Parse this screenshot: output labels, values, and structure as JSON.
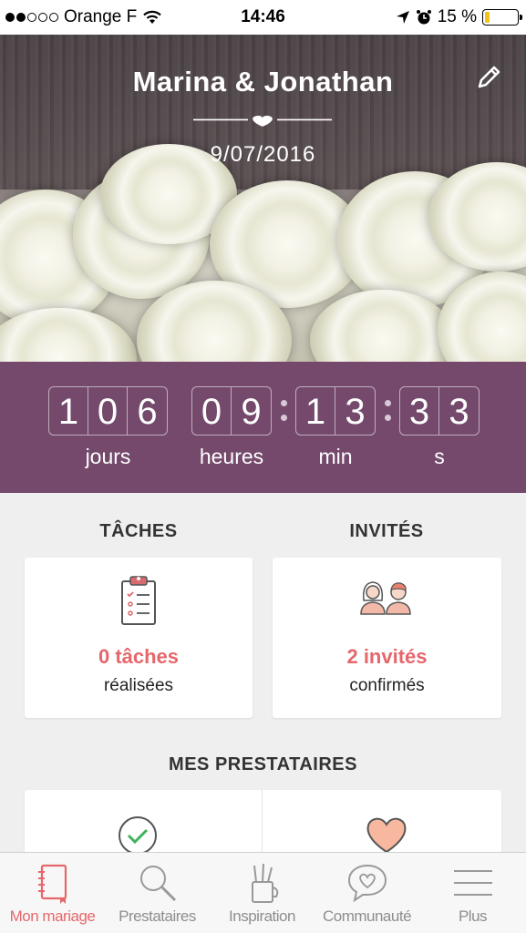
{
  "status_bar": {
    "carrier": "Orange F",
    "time": "14:46",
    "battery_percent": "15 %",
    "battery_level": 0.15,
    "signal_bars": 2
  },
  "hero": {
    "title": "Marina & Jonathan",
    "date": "9/07/2016"
  },
  "countdown": {
    "days": [
      "1",
      "0",
      "6"
    ],
    "days_label": "jours",
    "hours": [
      "0",
      "9"
    ],
    "hours_label": "heures",
    "minutes": [
      "1",
      "3"
    ],
    "minutes_label": "min",
    "seconds": [
      "3",
      "3"
    ],
    "seconds_label": "s"
  },
  "tasks": {
    "title": "TÂCHES",
    "count": "0 tâches",
    "sub": "réalisées"
  },
  "guests": {
    "title": "INVITÉS",
    "count": "2 invités",
    "sub": "confirmés"
  },
  "vendors": {
    "title": "MES PRESTATAIRES"
  },
  "tabbar": {
    "items": [
      {
        "label": "Mon mariage",
        "icon": "notebook-icon",
        "active": true
      },
      {
        "label": "Prestataires",
        "icon": "search-icon",
        "active": false
      },
      {
        "label": "Inspiration",
        "icon": "pencil-cup-icon",
        "active": false
      },
      {
        "label": "Communauté",
        "icon": "chat-heart-icon",
        "active": false
      },
      {
        "label": "Plus",
        "icon": "menu-icon",
        "active": false
      }
    ]
  },
  "colors": {
    "accent": "#e5676b",
    "countdown_bg": "#74496c",
    "battery": "#f2c21b"
  }
}
